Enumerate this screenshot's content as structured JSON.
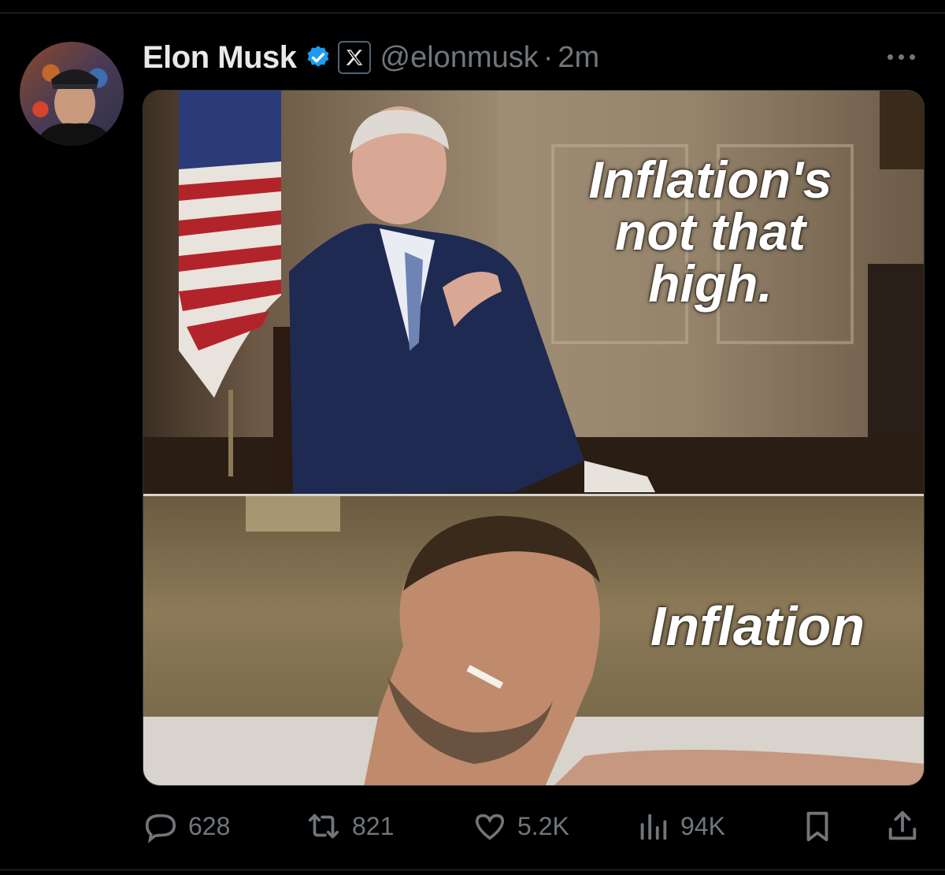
{
  "tweet": {
    "author_name": "Elon Musk",
    "handle": "@elonmusk",
    "separator": "·",
    "time": "2m",
    "verified_color": "#1d9bf0"
  },
  "meme": {
    "top_caption": "Inflation's not that high.",
    "bottom_caption": "Inflation"
  },
  "actions": {
    "replies": "628",
    "reposts": "821",
    "likes": "5.2K",
    "views": "94K"
  },
  "icons": [
    "more-icon",
    "verified-icon",
    "x-affiliate-icon",
    "reply-icon",
    "repost-icon",
    "like-icon",
    "views-icon",
    "bookmark-icon",
    "share-icon"
  ]
}
